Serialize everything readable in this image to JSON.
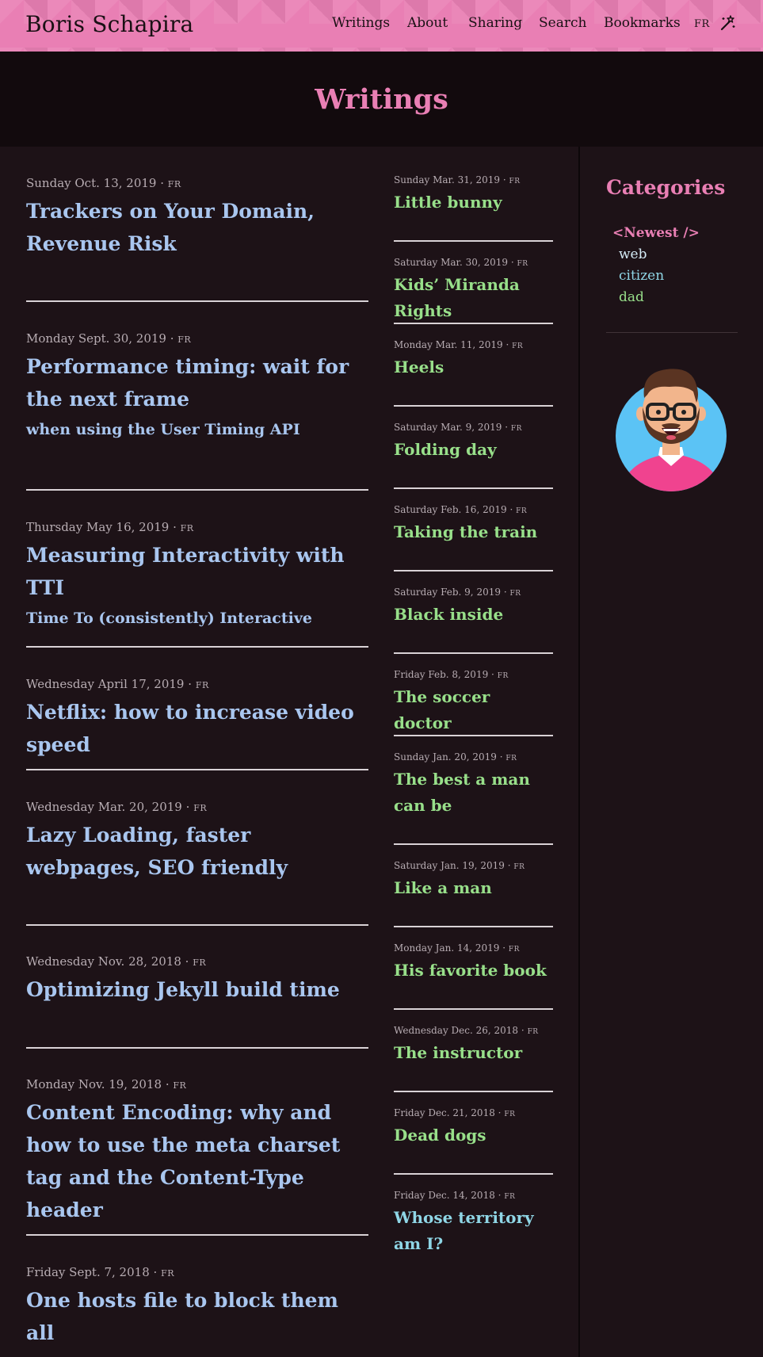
{
  "header": {
    "site_title": "Boris Schapira",
    "nav": [
      "Writings",
      "About",
      "Sharing",
      "Search",
      "Bookmarks"
    ],
    "lang": "FR",
    "theme_icon": "magic-wand-icon",
    "colors": {
      "header_bg": "#e97fb4",
      "accent": "#e97fb4"
    }
  },
  "page": {
    "title": "Writings"
  },
  "posts_main": [
    {
      "date": "Sunday Oct. 13, 2019",
      "lang": "FR",
      "title": "Trackers on Your Domain, Revenue Risk",
      "subtitle": ""
    },
    {
      "date": "Monday Sept. 30, 2019",
      "lang": "FR",
      "title": "Performance timing: wait for the next frame",
      "subtitle": "when using the User Timing API"
    },
    {
      "date": "Thursday May 16, 2019",
      "lang": "FR",
      "title": "Measuring Interactivity with TTI",
      "subtitle": "Time To (consistently) Interactive"
    },
    {
      "date": "Wednesday April 17, 2019",
      "lang": "FR",
      "title": "Netflix: how to increase video speed",
      "subtitle": ""
    },
    {
      "date": "Wednesday Mar. 20, 2019",
      "lang": "FR",
      "title": "Lazy Loading, faster webpages, SEO friendly",
      "subtitle": ""
    },
    {
      "date": "Wednesday Nov. 28, 2018",
      "lang": "FR",
      "title": "Optimizing Jekyll build time",
      "subtitle": ""
    },
    {
      "date": "Monday Nov. 19, 2018",
      "lang": "FR",
      "title": "Content Encoding: why and how to use the meta charset tag and the Content-Type header",
      "subtitle": ""
    },
    {
      "date": "Friday Sept. 7, 2018",
      "lang": "FR",
      "title": "One hosts file to block them all",
      "subtitle": ""
    }
  ],
  "posts_side": [
    {
      "date": "Sunday Mar. 31, 2019",
      "lang": "FR",
      "title": "Little bunny"
    },
    {
      "date": "Saturday Mar. 30, 2019",
      "lang": "FR",
      "title": "Kids’ Miranda Rights"
    },
    {
      "date": "Monday Mar. 11, 2019",
      "lang": "FR",
      "title": "Heels"
    },
    {
      "date": "Saturday Mar. 9, 2019",
      "lang": "FR",
      "title": "Folding day"
    },
    {
      "date": "Saturday Feb. 16, 2019",
      "lang": "FR",
      "title": "Taking the train"
    },
    {
      "date": "Saturday Feb. 9, 2019",
      "lang": "FR",
      "title": "Black inside"
    },
    {
      "date": "Friday Feb. 8, 2019",
      "lang": "FR",
      "title": "The soccer doctor"
    },
    {
      "date": "Sunday Jan. 20, 2019",
      "lang": "FR",
      "title": "The best a man can be"
    },
    {
      "date": "Saturday Jan. 19, 2019",
      "lang": "FR",
      "title": "Like a man"
    },
    {
      "date": "Monday Jan. 14, 2019",
      "lang": "FR",
      "title": "His favorite book"
    },
    {
      "date": "Wednesday Dec. 26, 2018",
      "lang": "FR",
      "title": "The instructor"
    },
    {
      "date": "Friday Dec. 21, 2018",
      "lang": "FR",
      "title": "Dead dogs"
    },
    {
      "date": "Friday Dec. 14, 2018",
      "lang": "FR",
      "title": "Whose territory am I?"
    }
  ],
  "sidebar": {
    "title": "Categories",
    "categories": [
      "<Newest />",
      "web",
      "citizen",
      "dad"
    ],
    "avatar_icon": "avatar-illustration"
  },
  "meta": {
    "separator": "·"
  }
}
